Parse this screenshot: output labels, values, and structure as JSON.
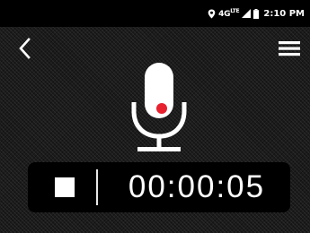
{
  "status_bar": {
    "network_label": "4G",
    "network_suffix": "LTE",
    "time": "2:10 PM"
  },
  "toolbar": {
    "back_icon": "chevron-left-icon",
    "menu_icon": "hamburger-menu-icon"
  },
  "recorder": {
    "mic_icon": "microphone-icon",
    "record_indicator_color": "#e8212f",
    "stop_icon": "stop-square-icon",
    "elapsed_time": "00:00:05"
  }
}
